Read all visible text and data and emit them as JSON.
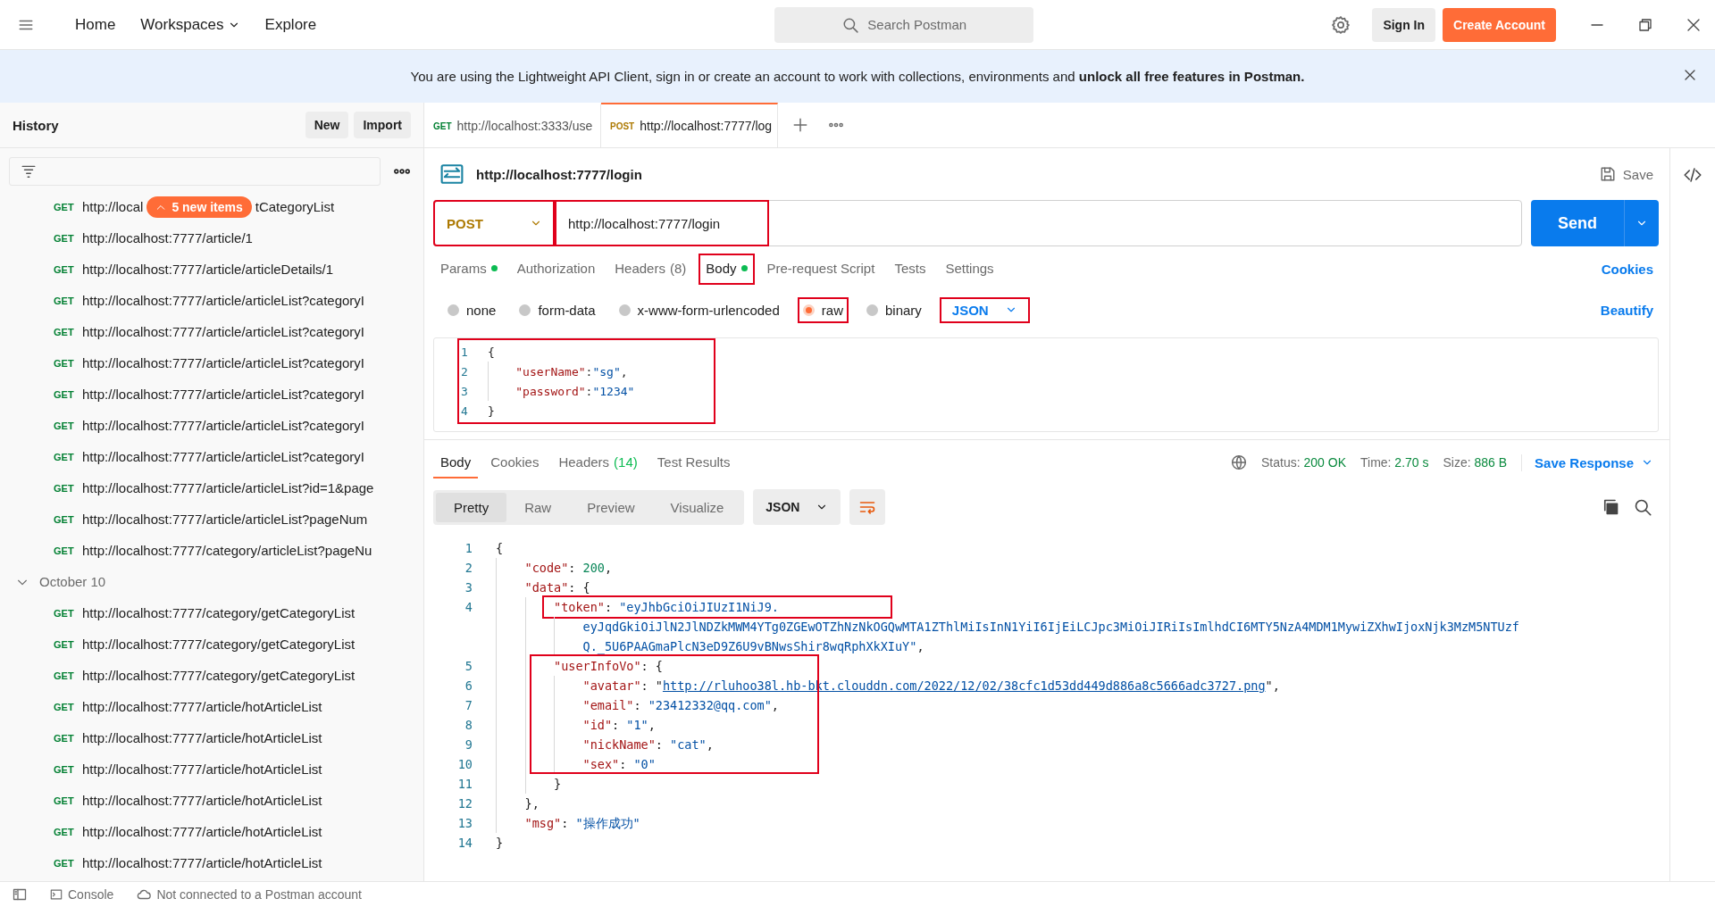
{
  "topbar": {
    "nav": [
      {
        "label": "Home",
        "caret": false
      },
      {
        "label": "Workspaces",
        "caret": true
      },
      {
        "label": "Explore",
        "caret": false
      }
    ],
    "search": {
      "placeholder": "Search Postman"
    },
    "sign_in": "Sign In",
    "create_account": "Create Account"
  },
  "banner": {
    "text": "You are using the Lightweight API Client, sign in or create an account to work with collections, environments and **unlock all free features in Postman.**"
  },
  "sidebar": {
    "title": "History",
    "buttons": [
      "New",
      "Import"
    ],
    "badge": "5 new items",
    "groups": [
      {
        "items": [
          {
            "method": "GET",
            "url": "http://local",
            "url_after_badge": "tCategoryList"
          },
          {
            "method": "GET",
            "url": "http://localhost:7777/article/1"
          },
          {
            "method": "GET",
            "url": "http://localhost:7777/article/articleDetails/1"
          },
          {
            "method": "GET",
            "url": "http://localhost:7777/article/articleList?categoryI"
          },
          {
            "method": "GET",
            "url": "http://localhost:7777/article/articleList?categoryI"
          },
          {
            "method": "GET",
            "url": "http://localhost:7777/article/articleList?categoryI"
          },
          {
            "method": "GET",
            "url": "http://localhost:7777/article/articleList?categoryI"
          },
          {
            "method": "GET",
            "url": "http://localhost:7777/article/articleList?categoryI"
          },
          {
            "method": "GET",
            "url": "http://localhost:7777/article/articleList?categoryI"
          },
          {
            "method": "GET",
            "url": "http://localhost:7777/article/articleList?id=1&page"
          },
          {
            "method": "GET",
            "url": "http://localhost:7777/article/articleList?pageNum"
          },
          {
            "method": "GET",
            "url": "http://localhost:7777/category/articleList?pageNu"
          }
        ]
      },
      {
        "label": "October 10",
        "expanded": true,
        "items": [
          {
            "method": "GET",
            "url": "http://localhost:7777/category/getCategoryList"
          },
          {
            "method": "GET",
            "url": "http://localhost:7777/category/getCategoryList"
          },
          {
            "method": "GET",
            "url": "http://localhost:7777/category/getCategoryList"
          },
          {
            "method": "GET",
            "url": "http://localhost:7777/article/hotArticleList"
          },
          {
            "method": "GET",
            "url": "http://localhost:7777/article/hotArticleList"
          },
          {
            "method": "GET",
            "url": "http://localhost:7777/article/hotArticleList"
          },
          {
            "method": "GET",
            "url": "http://localhost:7777/article/hotArticleList"
          },
          {
            "method": "GET",
            "url": "http://localhost:7777/article/hotArticleList"
          },
          {
            "method": "GET",
            "url": "http://localhost:7777/article/hotArticleList"
          }
        ]
      }
    ]
  },
  "tabs": [
    {
      "method": "GET",
      "label": "http://localhost:3333/use",
      "selected": false
    },
    {
      "method": "POST",
      "label": "http://localhost:7777/log",
      "selected": true
    }
  ],
  "request": {
    "title": "http://localhost:7777/login",
    "save": "Save",
    "method": {
      "value": "POST",
      "annotated": true
    },
    "url": {
      "value": "http://localhost:7777/login",
      "annotated": true
    },
    "send": "Send",
    "tabs": [
      {
        "label": "Params",
        "dot": true,
        "selected": false,
        "annotated": false
      },
      {
        "label": "Authorization",
        "dot": false,
        "selected": false,
        "annotated": false
      },
      {
        "label": "Headers",
        "count": "(8)",
        "dot": false,
        "selected": false,
        "annotated": false
      },
      {
        "label": "Body",
        "dot": true,
        "selected": true,
        "annotated": true
      },
      {
        "label": "Pre-request Script",
        "dot": false,
        "selected": false,
        "annotated": false
      },
      {
        "label": "Tests",
        "dot": false,
        "selected": false,
        "annotated": false
      },
      {
        "label": "Settings",
        "dot": false,
        "selected": false,
        "annotated": false
      }
    ],
    "cookies": "Cookies",
    "body_types": [
      {
        "label": "none",
        "selected": false,
        "annotated": false
      },
      {
        "label": "form-data",
        "selected": false,
        "annotated": false
      },
      {
        "label": "x-www-form-urlencoded",
        "selected": false,
        "annotated": false
      },
      {
        "label": "raw",
        "selected": true,
        "annotated": true
      },
      {
        "label": "binary",
        "selected": false,
        "annotated": false
      }
    ],
    "format": {
      "value": "JSON",
      "annotated": true
    },
    "beautify": "Beautify",
    "body": {
      "annotated": true,
      "rows": [
        {
          "n": "1",
          "parts": [
            {
              "kind": "p",
              "t": "{"
            }
          ]
        },
        {
          "n": "2",
          "parts": [
            {
              "kind": "indent"
            },
            {
              "kind": "key",
              "t": "\"userName\""
            },
            {
              "kind": "p",
              "t": ":"
            },
            {
              "kind": "str",
              "t": "\"sg\""
            },
            {
              "kind": "p",
              "t": ","
            }
          ]
        },
        {
          "n": "3",
          "parts": [
            {
              "kind": "indent"
            },
            {
              "kind": "key",
              "t": "\"password\""
            },
            {
              "kind": "p",
              "t": ":"
            },
            {
              "kind": "str",
              "t": "\"1234\""
            }
          ]
        },
        {
          "n": "4",
          "parts": [
            {
              "kind": "p",
              "t": "}"
            }
          ]
        }
      ]
    }
  },
  "response": {
    "tabs": [
      {
        "label": "Body",
        "selected": true
      },
      {
        "label": "Cookies",
        "selected": false
      },
      {
        "label": "Headers",
        "count": "(14)",
        "selected": false
      },
      {
        "label": "Test Results",
        "selected": false
      }
    ],
    "status": [
      {
        "label": "Status:",
        "value": "200 OK"
      },
      {
        "label": "Time:",
        "value": "2.70 s"
      },
      {
        "label": "Size:",
        "value": "886 B"
      }
    ],
    "save_response": "Save Response",
    "views": [
      {
        "label": "Pretty",
        "selected": true
      },
      {
        "label": "Raw",
        "selected": false
      },
      {
        "label": "Preview",
        "selected": false
      },
      {
        "label": "Visualize",
        "selected": false
      }
    ],
    "format": "JSON",
    "blocks": [
      {
        "annotated": false,
        "rows": [
          {
            "n": "1",
            "parts": [
              {
                "kind": "p",
                "t": "{"
              }
            ]
          },
          {
            "n": "2",
            "parts": [
              {
                "kind": "indent"
              },
              {
                "kind": "key",
                "t": "\"code\""
              },
              {
                "kind": "p",
                "t": ": "
              },
              {
                "kind": "num",
                "t": "200"
              },
              {
                "kind": "p",
                "t": ","
              }
            ]
          },
          {
            "n": "3",
            "parts": [
              {
                "kind": "indent"
              },
              {
                "kind": "key",
                "t": "\"data\""
              },
              {
                "kind": "p",
                "t": ": {"
              }
            ]
          }
        ]
      },
      {
        "annotated": true,
        "rows": [
          {
            "n": "4",
            "parts": [
              {
                "kind": "indent"
              },
              {
                "kind": "indent"
              },
              {
                "kind": "key",
                "t": "\"token\""
              },
              {
                "kind": "p",
                "t": ": "
              },
              {
                "kind": "str",
                "t": "\"eyJhbGciOiJIUzI1NiJ9."
              }
            ]
          }
        ]
      },
      {
        "annotated": false,
        "rows": [
          {
            "parts": [
              {
                "kind": "indent"
              },
              {
                "kind": "indent"
              },
              {
                "kind": "indent"
              },
              {
                "kind": "str",
                "t": "eyJqdGkiOiJlN2JlNDZkMWM4YTg0ZGEwOTZhNzNkOGQwMTA1ZThlMiIsInN1YiI6IjEiLCJpc3MiOiJIRiIsImlhdCI6MTY5NzA4MDM1MywiZXhwIjoxNjk3MzM5NTUzf"
              }
            ]
          },
          {
            "parts": [
              {
                "kind": "indent"
              },
              {
                "kind": "indent"
              },
              {
                "kind": "indent"
              },
              {
                "kind": "str",
                "t": "Q._5U6PAAGmaPlcN3eD9Z6U9vBNwsShir8wqRphXkXIuY\""
              },
              {
                "kind": "p",
                "t": ","
              }
            ]
          }
        ]
      },
      {
        "annotated": true,
        "rows": [
          {
            "n": "5",
            "parts": [
              {
                "kind": "indent"
              },
              {
                "kind": "indent"
              },
              {
                "kind": "key",
                "t": "\"userInfoVo\""
              },
              {
                "kind": "p",
                "t": ": {"
              }
            ]
          },
          {
            "n": "6",
            "parts": [
              {
                "kind": "indent"
              },
              {
                "kind": "indent"
              },
              {
                "kind": "indent"
              },
              {
                "kind": "key",
                "t": "\"avatar\""
              },
              {
                "kind": "p",
                "t": ": \""
              },
              {
                "kind": "link",
                "t": "http://rluhoo38l.hb-bkt.clouddn.com/2022/12/02/38cfc1d53dd449d886a8c5666adc3727.png"
              },
              {
                "kind": "p",
                "t": "\","
              }
            ]
          },
          {
            "n": "7",
            "parts": [
              {
                "kind": "indent"
              },
              {
                "kind": "indent"
              },
              {
                "kind": "indent"
              },
              {
                "kind": "key",
                "t": "\"email\""
              },
              {
                "kind": "p",
                "t": ": "
              },
              {
                "kind": "str",
                "t": "\"23412332@qq.com\""
              },
              {
                "kind": "p",
                "t": ","
              }
            ]
          },
          {
            "n": "8",
            "parts": [
              {
                "kind": "indent"
              },
              {
                "kind": "indent"
              },
              {
                "kind": "indent"
              },
              {
                "kind": "key",
                "t": "\"id\""
              },
              {
                "kind": "p",
                "t": ": "
              },
              {
                "kind": "str",
                "t": "\"1\""
              },
              {
                "kind": "p",
                "t": ","
              }
            ]
          },
          {
            "n": "9",
            "parts": [
              {
                "kind": "indent"
              },
              {
                "kind": "indent"
              },
              {
                "kind": "indent"
              },
              {
                "kind": "key",
                "t": "\"nickName\""
              },
              {
                "kind": "p",
                "t": ": "
              },
              {
                "kind": "str",
                "t": "\"cat\""
              },
              {
                "kind": "p",
                "t": ","
              }
            ]
          },
          {
            "n": "10",
            "parts": [
              {
                "kind": "indent"
              },
              {
                "kind": "indent"
              },
              {
                "kind": "indent"
              },
              {
                "kind": "key",
                "t": "\"sex\""
              },
              {
                "kind": "p",
                "t": ": "
              },
              {
                "kind": "str",
                "t": "\"0\""
              }
            ]
          }
        ]
      },
      {
        "annotated": false,
        "rows": [
          {
            "n": "11",
            "parts": [
              {
                "kind": "indent"
              },
              {
                "kind": "indent"
              },
              {
                "kind": "p",
                "t": "}"
              }
            ]
          },
          {
            "n": "12",
            "parts": [
              {
                "kind": "indent"
              },
              {
                "kind": "p",
                "t": "},"
              }
            ]
          },
          {
            "n": "13",
            "parts": [
              {
                "kind": "indent"
              },
              {
                "kind": "key",
                "t": "\"msg\""
              },
              {
                "kind": "p",
                "t": ": "
              },
              {
                "kind": "str",
                "t": "\"操作成功\""
              }
            ]
          },
          {
            "n": "14",
            "parts": [
              {
                "kind": "p",
                "t": "}"
              }
            ]
          }
        ]
      }
    ]
  },
  "status_bar": {
    "console": "Console",
    "connection": "Not connected to a Postman account"
  }
}
